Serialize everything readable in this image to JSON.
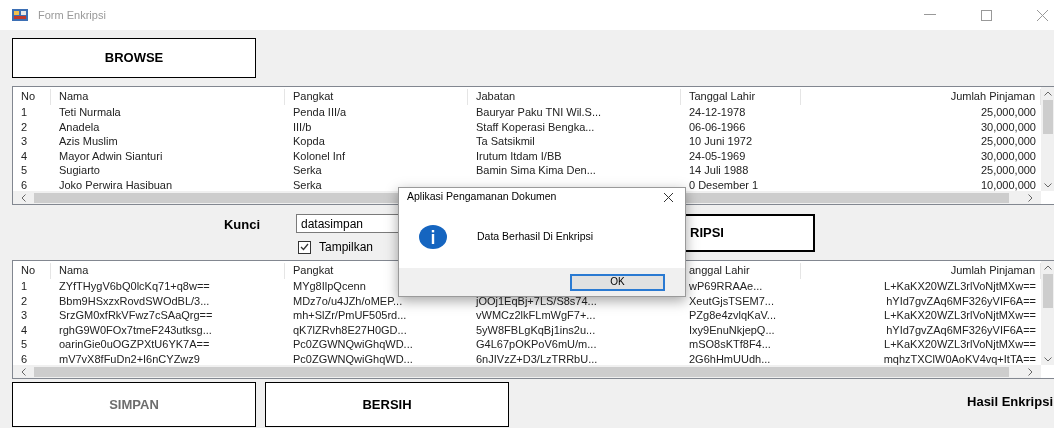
{
  "window": {
    "title": "Form Enkripsi"
  },
  "browse_button": "BROWSE",
  "source_table": {
    "columns": [
      "No",
      "Nama",
      "Pangkat",
      "Jabatan",
      "Tanggal Lahir",
      "Jumlah Pinjaman"
    ],
    "rows": [
      [
        "1",
        "Teti Nurmala",
        "Penda III/a",
        "Bauryar Paku TNI Wil.S...",
        "24-12-1978",
        "25,000,000"
      ],
      [
        "2",
        "Anadela",
        "III/b",
        "Staff Koperasi Bengka...",
        "06-06-1966",
        "30,000,000"
      ],
      [
        "3",
        "Azis Muslim",
        "Kopda",
        "Ta Satsikmil",
        "10 Juni 1972",
        "25,000,000"
      ],
      [
        "4",
        "Mayor Adwin Sianturi",
        "Kolonel Inf",
        "Irutum Itdam I/BB",
        "24-05-1969",
        "30,000,000"
      ],
      [
        "5",
        "Sugiarto",
        "Serka",
        "Bamin Sima Kima Den...",
        "14 Juli 1988",
        "25,000,000"
      ],
      [
        "6",
        "Joko Perwira Hasibuan",
        "Serka",
        null,
        "0 Desember 1",
        "10,000,000"
      ]
    ]
  },
  "key": {
    "label": "Kunci",
    "value": "datasimpan",
    "show_key": {
      "label": "Tampilkan",
      "checked": true
    }
  },
  "encrypt_button": "RIPSI",
  "result_table": {
    "columns": [
      "No",
      "Nama",
      "Pangkat",
      null,
      "anggal Lahir",
      "Jumlah Pinjaman"
    ],
    "rows": [
      [
        "1",
        "ZYfTHygV6bQ0lcKq71+q8w==",
        "MYg8IlpQcenn",
        null,
        "wP69RRAAe...",
        "L+KaKX20WZL3rlVoNjtMXw=="
      ],
      [
        "2",
        "Bbm9HSxzxRovdSWOdBL/3...",
        "MDz7o/u4JZh/oMEP...",
        "jOOj1EqBj+7LS/S8s74...",
        "XeutGjsTSEM7...",
        "hYId7gvZAq6MF326yVIF6A=="
      ],
      [
        "3",
        "SrzGM0xfRkVFwz7cSAaQrg==",
        "mh+SlZr/PmUF505rd...",
        "vWMCz2lkFLmWgF7+...",
        "PZg8e4zvlqKaV...",
        "L+KaKX20WZL3rlVoNjtMXw=="
      ],
      [
        "4",
        "rghG9W0FOx7tmeF243utksg...",
        "qK7lZRvh8E27H0GD...",
        "5yW8FBLgKqBj1ins2u...",
        "Ixy9EnuNkjepQ...",
        "hYId7gvZAq6MF326yVIF6A=="
      ],
      [
        "5",
        "oarinGie0uOGZPXtU6YK7A==",
        "Pc0ZGWNQwiGhqWD...",
        "G4L67pOKPoV6mU/m...",
        "mSO8sKTf8F4...",
        "L+KaKX20WZL3rlVoNjtMXw=="
      ],
      [
        "6",
        "mV7vX8fFuDn2+I6nCYZwz9",
        "Pc0ZGWNQwiGhqWD...",
        "6nJIVzZ+D3/LzTRRbU...",
        "2G6hHmUUdh...",
        "mqhzTXClW0AoKV4vq+ItTA=="
      ]
    ]
  },
  "bottom_buttons": [
    {
      "label": "SIMPAN",
      "disabled": true
    },
    {
      "label": "BERSIH",
      "disabled": false
    }
  ],
  "result_label": "Hasil Enkripsi",
  "dialog": {
    "title": "Aplikasi Pengamanan Dokumen",
    "message": "Data Berhasil Di Enkripsi",
    "ok_button": "OK"
  }
}
